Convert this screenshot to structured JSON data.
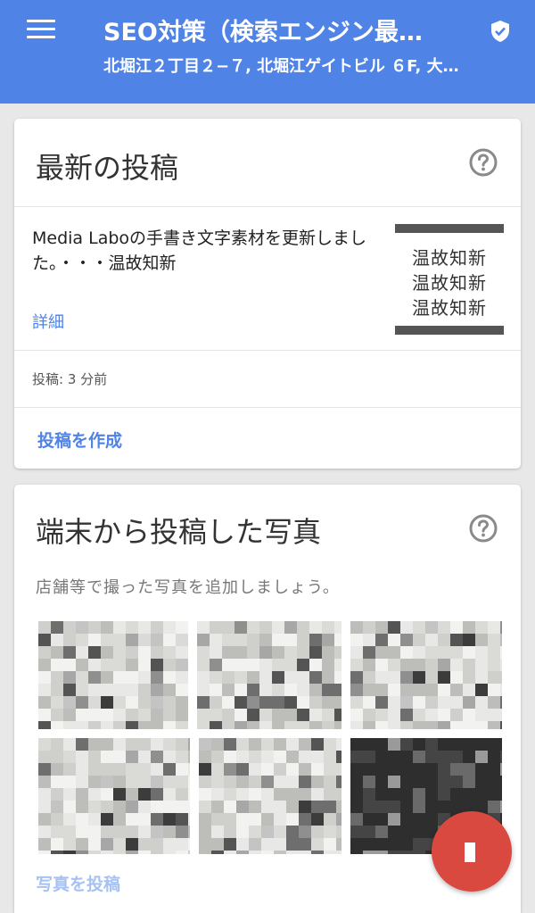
{
  "appbar": {
    "title": "SEO対策（検索エンジン最…",
    "subtitle": "北堀江２丁目２−７, 北堀江ゲイトビル ６F, 大…",
    "menu_icon": "menu-icon",
    "badge_icon": "verified-shield-icon",
    "color": "#4f83e6"
  },
  "posts_card": {
    "title": "最新の投稿",
    "help_icon": "help-icon",
    "post": {
      "text": "Media Laboの手書き文字素材を更新しました。・・・温故知新",
      "detail_label": "詳細",
      "image_lines": [
        "温故知新",
        "温故知新",
        "温故知新"
      ],
      "time_label": "投稿: 3 分前"
    },
    "create_label": "投稿を作成"
  },
  "photos_card": {
    "title": "端末から投稿した写真",
    "help_icon": "help-icon",
    "hint": "店舗等で撮った写真を追加しましょう。",
    "photo_count": 6,
    "post_label": "写真を投稿"
  },
  "fab": {
    "icon": "add-icon",
    "color": "#d9493f"
  }
}
